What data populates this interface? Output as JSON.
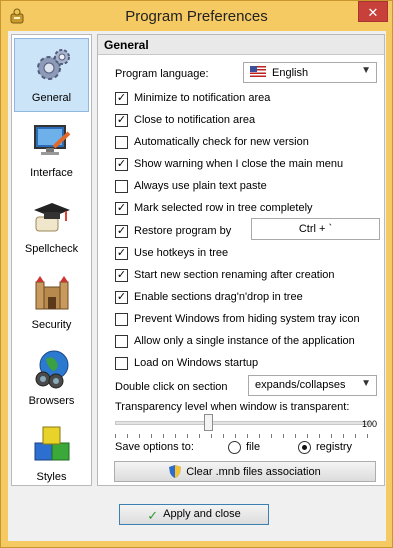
{
  "window": {
    "title": "Program Preferences",
    "close_glyph": "✕",
    "app_icon": "app-icon"
  },
  "sidebar": {
    "items": [
      {
        "label": "General",
        "icon": "gears-icon",
        "active": true
      },
      {
        "label": "Interface",
        "icon": "monitor-icon",
        "active": false
      },
      {
        "label": "Spellcheck",
        "icon": "graduation-cap-icon",
        "active": false
      },
      {
        "label": "Security",
        "icon": "castle-icon",
        "active": false
      },
      {
        "label": "Browsers",
        "icon": "globe-binoculars-icon",
        "active": false
      },
      {
        "label": "Styles",
        "icon": "blocks-icon",
        "active": false
      }
    ]
  },
  "panel": {
    "title": "General",
    "language_label": "Program language:",
    "language_value": "English",
    "options": [
      {
        "label": "Minimize to notification area",
        "checked": true
      },
      {
        "label": "Close to notification area",
        "checked": true
      },
      {
        "label": "Automatically check for new version",
        "checked": false
      },
      {
        "label": "Show warning when I close the main menu",
        "checked": true
      },
      {
        "label": "Always use plain text paste",
        "checked": false
      },
      {
        "label": "Mark selected row in tree completely",
        "checked": true
      },
      {
        "label": "Restore program by",
        "checked": true
      },
      {
        "label": "Use hotkeys in tree",
        "checked": true
      },
      {
        "label": "Start new section renaming after creation",
        "checked": true
      },
      {
        "label": "Enable sections drag'n'drop in tree",
        "checked": true
      },
      {
        "label": "Prevent Windows from hiding system tray icon",
        "checked": false
      },
      {
        "label": "Allow only a single instance of the application",
        "checked": false
      },
      {
        "label": "Load on Windows startup",
        "checked": false
      }
    ],
    "hotkey_value": "Ctrl + `",
    "double_click_label": "Double click on section",
    "double_click_value": "expands/collapses",
    "transparency_label": "Transparency level when window is transparent:",
    "transparency_value": 100,
    "transparency_level": 0.36,
    "save_label": "Save options to:",
    "save_file": "file",
    "save_registry": "registry",
    "save_selected": "registry",
    "clear_button": "Clear .mnb files association"
  },
  "footer": {
    "apply_button": "Apply and close"
  },
  "check_glyph": "✓"
}
